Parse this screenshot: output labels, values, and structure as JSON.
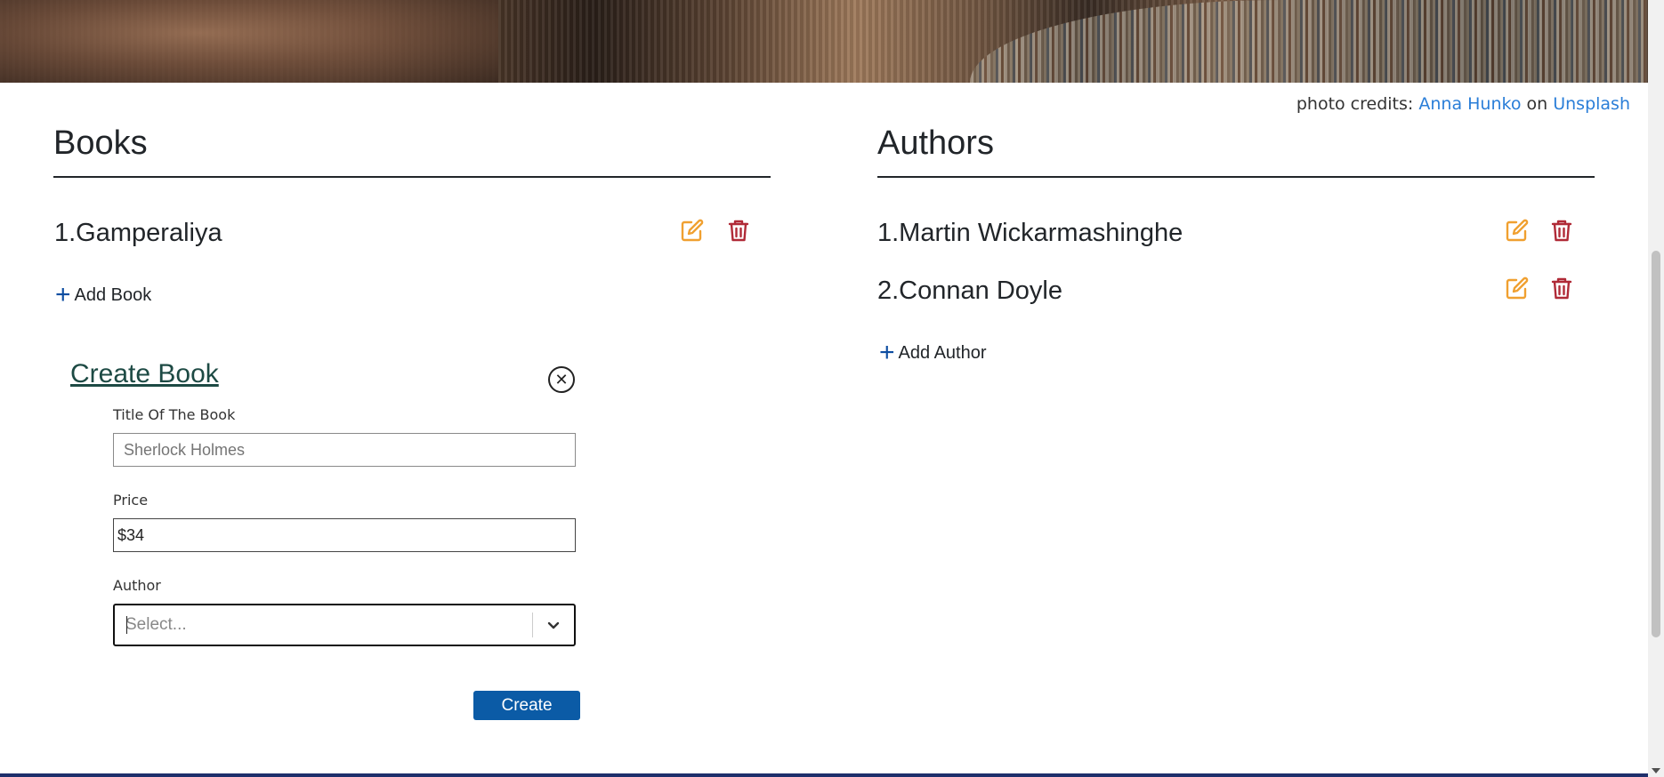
{
  "credits": {
    "prefix": "photo credits:",
    "author": "Anna Hunko",
    "middle": "on",
    "site": "Unsplash"
  },
  "books": {
    "title": "Books",
    "items": [
      {
        "name": "1.Gamperaliya"
      }
    ],
    "add_label": "Add Book"
  },
  "authors": {
    "title": "Authors",
    "items": [
      {
        "name": "1.Martin Wickarmashinghe"
      },
      {
        "name": "2.Connan Doyle"
      }
    ],
    "add_label": "Add Author"
  },
  "create_form": {
    "title": "Create Book",
    "title_label": "Title Of The Book",
    "title_placeholder": "Sherlock Holmes",
    "price_label": "Price",
    "price_value": "$34",
    "author_label": "Author",
    "author_placeholder": "Select...",
    "submit_label": "Create"
  },
  "colors": {
    "edit_icon": "#f0a030",
    "delete_icon": "#b02a37",
    "accent": "#0b5ba6",
    "link": "#2a7ed8"
  }
}
